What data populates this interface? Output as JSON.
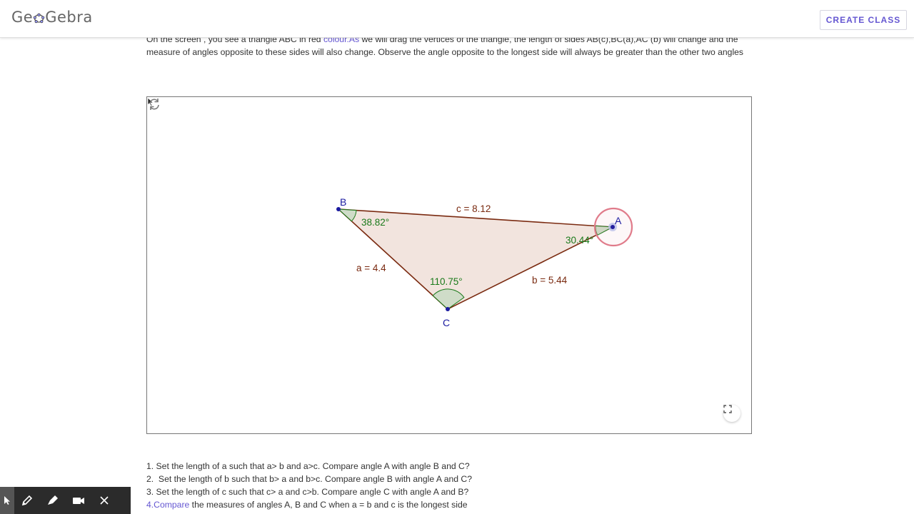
{
  "header": {
    "logo_text_pre": "Ge",
    "logo_text_post": "Gebra",
    "create_class_label": "CREATE CLASS"
  },
  "intro": {
    "part1": "On the screen , you see a triangle ABC in red ",
    "link": "colour.As",
    "part2": " we will drag the vertices of the triangle, the length of sides AB(c),BC(a),AC (b) will change and the measure of angles opposite to these sides will also change. Observe the angle opposite to the longest side will always be greater than the other two angles"
  },
  "applet": {
    "labels": {
      "vertex_a": "A",
      "vertex_b": "B",
      "vertex_c": "C",
      "side_a": "a = 4.4",
      "side_b": "b = 5.44",
      "side_c": "c = 8.12",
      "angle_a": "30.44°",
      "angle_b": "38.82°",
      "angle_c": "110.75°"
    },
    "colors": {
      "triangle_stroke": "#7a2a10",
      "triangle_fill": "#f2e4de",
      "vertex": "#1a1aa0",
      "angle_label": "#1a7a1a",
      "highlight_ring": "#e07b8a"
    }
  },
  "tasks": [
    {
      "prefix": "",
      "text": "1. Set the length of a such that a> b and a>c. Compare angle A with angle B and C?"
    },
    {
      "prefix": "",
      "text": "2.  Set the length of b such that b> a and b>c. Compare angle B with angle A and C?"
    },
    {
      "prefix": "",
      "text": "3. Set the length of c such that c> a and c>b. Compare angle C with angle A and B?"
    },
    {
      "prefix": "4.Compare",
      "text": " the measures of angles A, B and C when a = b and c is the longest side"
    }
  ],
  "toolbar": {
    "icons": [
      "pointer-icon",
      "pen-icon",
      "highlighter-icon",
      "video-icon",
      "close-icon"
    ]
  }
}
